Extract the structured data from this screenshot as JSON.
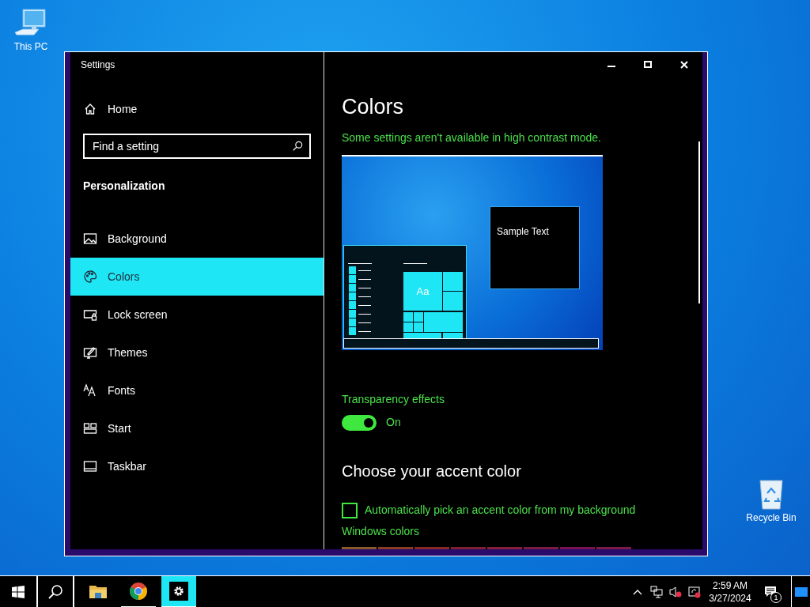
{
  "desktop_icons": [
    {
      "label": "This PC"
    },
    {
      "label": "Recycle Bin"
    }
  ],
  "window": {
    "title": "Settings"
  },
  "sidebar": {
    "home": "Home",
    "search": {
      "placeholder": "Find a setting"
    },
    "section": "Personalization",
    "items": [
      {
        "label": "Background",
        "selected": false
      },
      {
        "label": "Colors",
        "selected": true
      },
      {
        "label": "Lock screen",
        "selected": false
      },
      {
        "label": "Themes",
        "selected": false
      },
      {
        "label": "Fonts",
        "selected": false
      },
      {
        "label": "Start",
        "selected": false
      },
      {
        "label": "Taskbar",
        "selected": false
      }
    ]
  },
  "content": {
    "title": "Colors",
    "notice": "Some settings aren't available in high contrast mode.",
    "preview": {
      "sample_text": "Sample Text",
      "tile_text": "Aa"
    },
    "transparency": {
      "label": "Transparency effects",
      "on": true,
      "state_text": "On"
    },
    "accent_heading": "Choose your accent color",
    "auto_pick": {
      "label": "Automatically pick an accent color from my background",
      "checked": false
    },
    "windows_colors": {
      "label": "Windows colors",
      "swatches": [
        {
          "color": "#8a5a2a"
        },
        {
          "color": "#8a3c24"
        },
        {
          "color": "#8a2a26"
        },
        {
          "color": "#7e2232"
        },
        {
          "color": "#86203a"
        },
        {
          "color": "#7a1c44"
        },
        {
          "color": "#7a1450"
        },
        {
          "color": "#7c1a48"
        }
      ]
    }
  },
  "taskbar": {
    "apps": [
      {
        "selected": false,
        "open": false
      },
      {
        "selected": false,
        "open": true
      },
      {
        "selected": true,
        "open": true
      }
    ],
    "time": "2:59 AM",
    "date": "3/27/2024",
    "notification_count": "1"
  }
}
